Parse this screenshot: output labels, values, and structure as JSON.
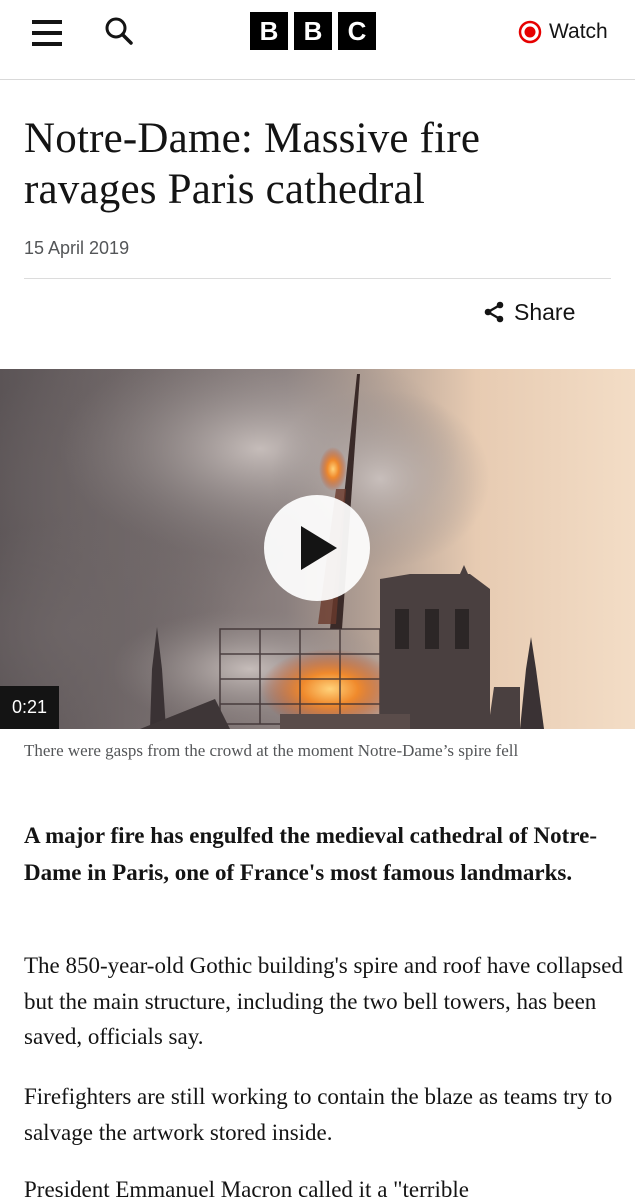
{
  "header": {
    "logo_letters": [
      "B",
      "B",
      "C"
    ],
    "watch_label": "Watch",
    "icons": {
      "menu": "hamburger-menu-icon",
      "search": "search-icon",
      "watch": "live-record-icon"
    },
    "accent_color": "#e60000"
  },
  "article": {
    "headline": "Notre-Dame: Massive fire ravages Paris cathedral",
    "date": "15 April 2019",
    "share_label": "Share",
    "media": {
      "duration": "0:21",
      "caption": "There were gasps from the crowd at the moment Notre-Dame’s spire fell"
    },
    "lead": "A major fire has engulfed the medieval cathedral of Notre-Dame in Paris, one of France's most famous landmarks.",
    "paragraphs": [
      "The 850-year-old Gothic building's spire and roof have collapsed but the main structure, including the two bell towers, has been saved, officials say.",
      "Firefighters are still working to contain the blaze as teams try to salvage the artwork stored inside.",
      "President Emmanuel Macron called it a \"terrible"
    ]
  }
}
